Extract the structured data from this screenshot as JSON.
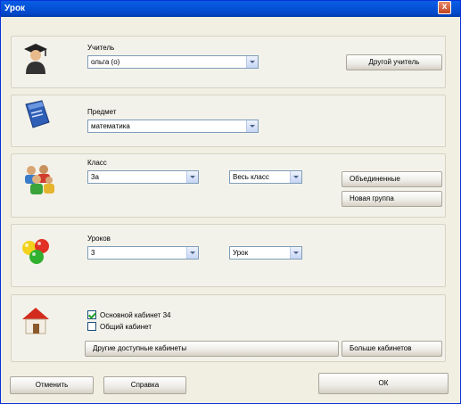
{
  "window": {
    "title": "Урок",
    "close": "x"
  },
  "teacher": {
    "label": "Учитель",
    "value": "ольга (о)",
    "other_button": "Другой учитель",
    "icon": "teacher-graduate-icon"
  },
  "subject": {
    "label": "Предмет",
    "value": "математика",
    "icon": "book-icon"
  },
  "class": {
    "label": "Класс",
    "value": "3а",
    "group_value": "Весь класс",
    "merged_button": "Объединенные",
    "new_group_button": "Новая группа",
    "icon": "students-group-icon"
  },
  "lessons": {
    "label": "Уроков",
    "value": "3",
    "type_value": "Урок",
    "icon": "balls-icon"
  },
  "room": {
    "main_room_label": "Основной кабинет 34",
    "main_room_checked": true,
    "shared_room_label": "Общий кабинет",
    "shared_room_checked": false,
    "other_available_button": "Другие доступные кабинеты",
    "more_rooms_button": "Больше кабинетов",
    "icon": "house-icon"
  },
  "footer": {
    "cancel": "Отменить",
    "help": "Справка",
    "ok": "ОК"
  }
}
